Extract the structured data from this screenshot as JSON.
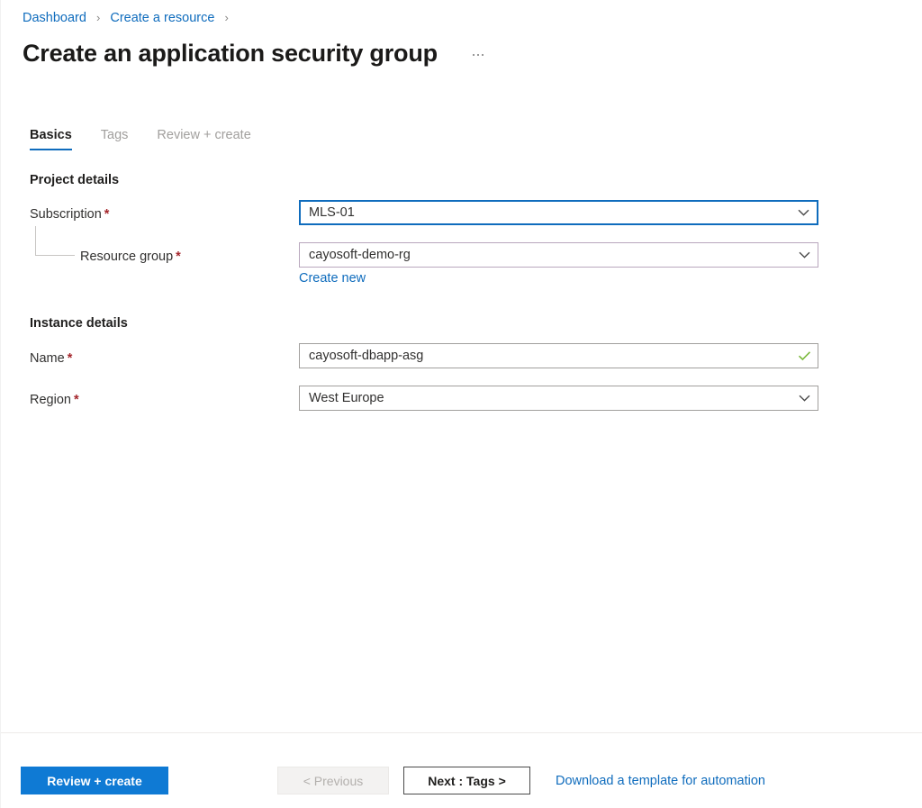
{
  "breadcrumb": {
    "items": [
      {
        "label": "Dashboard"
      },
      {
        "label": "Create a resource"
      }
    ],
    "separator": "›"
  },
  "header": {
    "title": "Create an application security group",
    "more_menu": "…"
  },
  "tabs": [
    {
      "label": "Basics",
      "active": true
    },
    {
      "label": "Tags",
      "active": false
    },
    {
      "label": "Review + create",
      "active": false
    }
  ],
  "sections": {
    "project_details": {
      "heading": "Project details",
      "fields": {
        "subscription": {
          "label": "Subscription",
          "required": "*",
          "value": "MLS-01",
          "icon": "chevron-down-icon",
          "state": "focused"
        },
        "resource_group": {
          "label": "Resource group",
          "required": "*",
          "value": "cayosoft-demo-rg",
          "icon": "chevron-down-icon",
          "create_new_link": "Create new"
        }
      }
    },
    "instance_details": {
      "heading": "Instance details",
      "fields": {
        "name": {
          "label": "Name",
          "required": "*",
          "value": "cayosoft-dbapp-asg",
          "icon": "checkmark-icon",
          "state": "valid"
        },
        "region": {
          "label": "Region",
          "required": "*",
          "value": "West Europe",
          "icon": "chevron-down-icon"
        }
      }
    }
  },
  "footer": {
    "review_create": "Review + create",
    "previous": "< Previous",
    "next": "Next : Tags >",
    "download_template": "Download a template for automation"
  },
  "colors": {
    "accent_blue": "#0f6cbd",
    "primary_button": "#0f7ad4",
    "link": "#0f6cbd",
    "required_asterisk": "#a4262c",
    "validation_green": "#7bb93c",
    "resource_group_border": "#b9a7bd"
  }
}
